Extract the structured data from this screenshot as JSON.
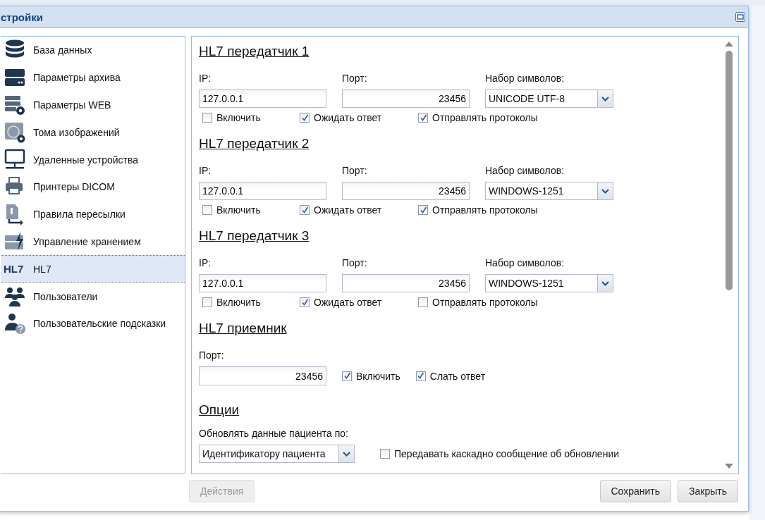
{
  "window": {
    "title": "стройки"
  },
  "sidebar": {
    "items": [
      {
        "kind": "database",
        "label": "База данных",
        "selected": false
      },
      {
        "kind": "server",
        "label": "Параметры архива",
        "selected": false
      },
      {
        "kind": "server-gear",
        "label": "Параметры WEB",
        "selected": false
      },
      {
        "kind": "globe-gear",
        "label": "Тома изображений",
        "selected": false
      },
      {
        "kind": "monitor",
        "label": "Удаленные устройства",
        "selected": false
      },
      {
        "kind": "printer",
        "label": "Принтеры DICOM",
        "selected": false
      },
      {
        "kind": "document-arrow",
        "label": "Правила пересылки",
        "selected": false
      },
      {
        "kind": "storage-bolt",
        "label": "Управление хранением",
        "selected": false
      },
      {
        "kind": "text",
        "icon_text": "HL7",
        "label": "HL7",
        "selected": true
      },
      {
        "kind": "users",
        "label": "Пользователи",
        "selected": false
      },
      {
        "kind": "user-help",
        "label": "Пользовательские подсказки",
        "selected": false
      }
    ]
  },
  "senders": [
    {
      "title": "HL7 передатчик 1",
      "ip_label": "IP:",
      "ip": "127.0.0.1",
      "port_label": "Порт:",
      "port": "23456",
      "charset_label": "Набор символов:",
      "charset": "UNICODE UTF-8",
      "checks": [
        {
          "label": "Включить",
          "checked": false
        },
        {
          "label": "Ожидать ответ",
          "checked": true
        },
        {
          "label": "Отправлять протоколы",
          "checked": true
        }
      ]
    },
    {
      "title": "HL7 передатчик 2",
      "ip_label": "IP:",
      "ip": "127.0.0.1",
      "port_label": "Порт:",
      "port": "23456",
      "charset_label": "Набор символов:",
      "charset": "WINDOWS-1251",
      "checks": [
        {
          "label": "Включить",
          "checked": false
        },
        {
          "label": "Ожидать ответ",
          "checked": true
        },
        {
          "label": "Отправлять протоколы",
          "checked": true
        }
      ]
    },
    {
      "title": "HL7 передатчик 3",
      "ip_label": "IP:",
      "ip": "127.0.0.1",
      "port_label": "Порт:",
      "port": "23456",
      "charset_label": "Набор символов:",
      "charset": "WINDOWS-1251",
      "checks": [
        {
          "label": "Включить",
          "checked": false
        },
        {
          "label": "Ожидать ответ",
          "checked": true
        },
        {
          "label": "Отправлять протоколы",
          "checked": false
        }
      ]
    }
  ],
  "receiver": {
    "title": "HL7 приемник",
    "port_label": "Порт:",
    "port": "23456",
    "checks": [
      {
        "label": "Включить",
        "checked": true
      },
      {
        "label": "Слать ответ",
        "checked": true
      }
    ]
  },
  "options": {
    "title": "Опции",
    "update_label": "Обновлять данные пациента по:",
    "update_by": "Идентификатору пациента",
    "cascade": {
      "label": "Передавать каскадно сообщение об обновлении",
      "checked": false
    }
  },
  "buttons": [
    {
      "label": "Действия",
      "disabled": true
    },
    {
      "label": "Сохранить",
      "disabled": false
    },
    {
      "label": "Закрыть",
      "disabled": false
    }
  ]
}
